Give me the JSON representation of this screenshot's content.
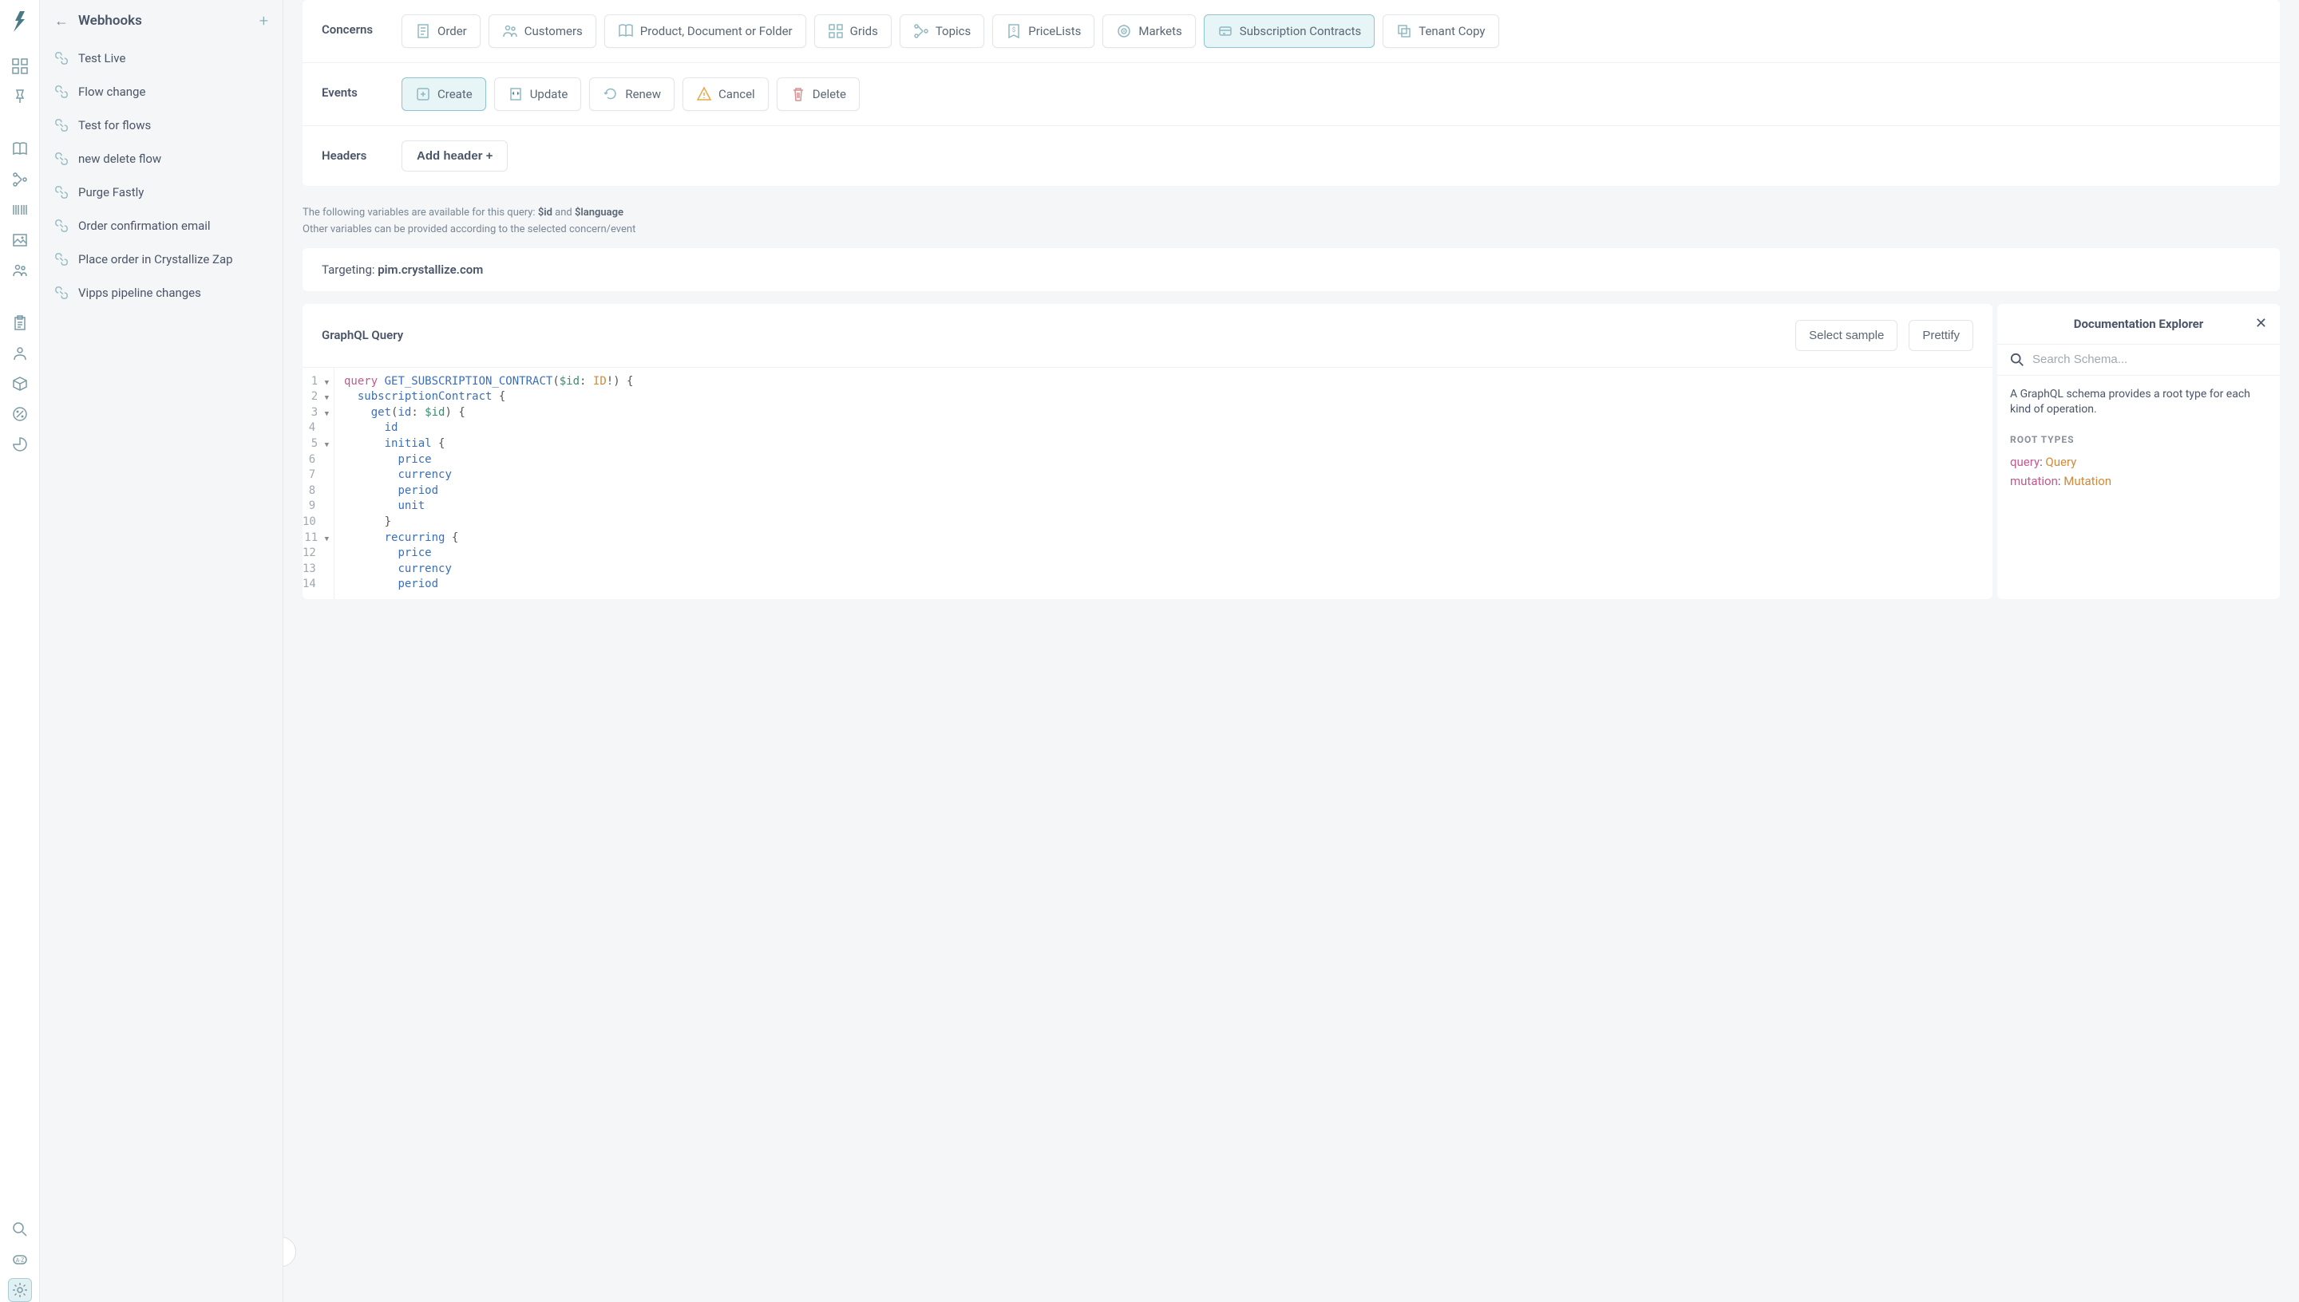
{
  "sidebar_title": "Webhooks",
  "webhooks": [
    "Test Live",
    "Flow change",
    "Test for flows",
    "new delete flow",
    "Purge Fastly",
    "Order confirmation email",
    "Place order in Crystallize Zap",
    "Vipps pipeline changes"
  ],
  "config": {
    "concerns_label": "Concerns",
    "events_label": "Events",
    "headers_label": "Headers",
    "add_header_label": "Add header +",
    "concerns": [
      {
        "label": "Order",
        "icon": "order"
      },
      {
        "label": "Customers",
        "icon": "customers"
      },
      {
        "label": "Product, Document or Folder",
        "icon": "book"
      },
      {
        "label": "Grids",
        "icon": "grids"
      },
      {
        "label": "Topics",
        "icon": "topics"
      },
      {
        "label": "PriceLists",
        "icon": "price"
      },
      {
        "label": "Markets",
        "icon": "markets"
      },
      {
        "label": "Subscription Contracts",
        "icon": "sub",
        "selected": true
      },
      {
        "label": "Tenant Copy",
        "icon": "copy"
      }
    ],
    "events": [
      {
        "label": "Create",
        "icon": "plus",
        "selected": true
      },
      {
        "label": "Update",
        "icon": "update"
      },
      {
        "label": "Renew",
        "icon": "renew"
      },
      {
        "label": "Cancel",
        "icon": "warn",
        "class": "yellow"
      },
      {
        "label": "Delete",
        "icon": "trash",
        "class": "danger"
      }
    ]
  },
  "variables_note": {
    "prefix": "The following variables are available for this query: ",
    "v1": "$id",
    "and": " and ",
    "v2": "$language",
    "line2": "Other variables can be provided according to the selected concern/event"
  },
  "targeting": {
    "label": "Targeting: ",
    "value": "pim.crystallize.com"
  },
  "query": {
    "title": "GraphQL Query",
    "select_sample": "Select sample",
    "prettify": "Prettify",
    "lines": [
      {
        "n": "1",
        "fold": true,
        "t": [
          {
            "c": "kw",
            "v": "query"
          },
          {
            "c": "",
            "v": " "
          },
          {
            "c": "fn",
            "v": "GET_SUBSCRIPTION_CONTRACT"
          },
          {
            "c": "punc",
            "v": "("
          },
          {
            "c": "var",
            "v": "$id"
          },
          {
            "c": "punc",
            "v": ": "
          },
          {
            "c": "type",
            "v": "ID"
          },
          {
            "c": "punc",
            "v": "!) {"
          }
        ]
      },
      {
        "n": "2",
        "fold": true,
        "t": [
          {
            "c": "",
            "v": "  "
          },
          {
            "c": "fn",
            "v": "subscriptionContract"
          },
          {
            "c": "",
            "v": " "
          },
          {
            "c": "punc",
            "v": "{"
          }
        ]
      },
      {
        "n": "3",
        "fold": true,
        "t": [
          {
            "c": "",
            "v": "    "
          },
          {
            "c": "fn",
            "v": "get"
          },
          {
            "c": "punc",
            "v": "("
          },
          {
            "c": "fn",
            "v": "id"
          },
          {
            "c": "punc",
            "v": ": "
          },
          {
            "c": "var",
            "v": "$id"
          },
          {
            "c": "punc",
            "v": ") {"
          }
        ]
      },
      {
        "n": "4",
        "t": [
          {
            "c": "",
            "v": "      "
          },
          {
            "c": "fn",
            "v": "id"
          }
        ]
      },
      {
        "n": "5",
        "fold": true,
        "t": [
          {
            "c": "",
            "v": "      "
          },
          {
            "c": "fn",
            "v": "initial"
          },
          {
            "c": "",
            "v": " "
          },
          {
            "c": "punc",
            "v": "{"
          }
        ]
      },
      {
        "n": "6",
        "t": [
          {
            "c": "",
            "v": "        "
          },
          {
            "c": "fn",
            "v": "price"
          }
        ]
      },
      {
        "n": "7",
        "t": [
          {
            "c": "",
            "v": "        "
          },
          {
            "c": "fn",
            "v": "currency"
          }
        ]
      },
      {
        "n": "8",
        "t": [
          {
            "c": "",
            "v": "        "
          },
          {
            "c": "fn",
            "v": "period"
          }
        ]
      },
      {
        "n": "9",
        "t": [
          {
            "c": "",
            "v": "        "
          },
          {
            "c": "fn",
            "v": "unit"
          }
        ]
      },
      {
        "n": "10",
        "t": [
          {
            "c": "",
            "v": "      "
          },
          {
            "c": "punc",
            "v": "}"
          }
        ]
      },
      {
        "n": "11",
        "fold": true,
        "t": [
          {
            "c": "",
            "v": "      "
          },
          {
            "c": "fn",
            "v": "recurring"
          },
          {
            "c": "",
            "v": " "
          },
          {
            "c": "punc",
            "v": "{"
          }
        ]
      },
      {
        "n": "12",
        "t": [
          {
            "c": "",
            "v": "        "
          },
          {
            "c": "fn",
            "v": "price"
          }
        ]
      },
      {
        "n": "13",
        "t": [
          {
            "c": "",
            "v": "        "
          },
          {
            "c": "fn",
            "v": "currency"
          }
        ]
      },
      {
        "n": "14",
        "t": [
          {
            "c": "",
            "v": "        "
          },
          {
            "c": "fn",
            "v": "period"
          }
        ]
      }
    ]
  },
  "doc": {
    "title": "Documentation Explorer",
    "search_placeholder": "Search Schema...",
    "desc": "A GraphQL schema provides a root type for each kind of operation.",
    "root_types_label": "ROOT TYPES",
    "types": [
      {
        "field": "query",
        "type": "Query"
      },
      {
        "field": "mutation",
        "type": "Mutation"
      }
    ]
  }
}
